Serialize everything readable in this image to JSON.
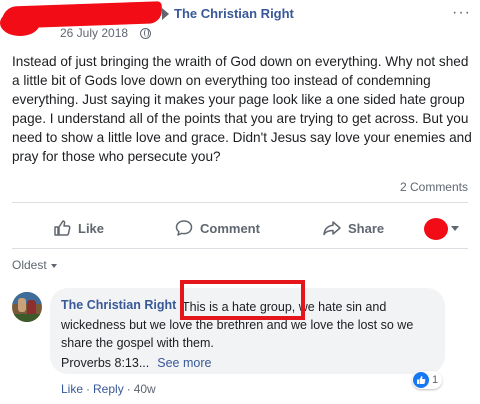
{
  "post": {
    "page_name": "The Christian Right",
    "date": "26 July 2018",
    "text": "Instead of just bringing the wraith of God down on everything. Why not shed a little bit of Gods love down on everything too instead of condemning everything. Just saying it makes your page look like a one sided hate group page. I understand all of the points that you are trying to get across. But you need to show a little love and grace. Didn't Jesus say love your enemies and pray for those who persecute you?",
    "comments_count": "2 Comments",
    "more_icon": "···"
  },
  "actions": {
    "like": "Like",
    "comment": "Comment",
    "share": "Share"
  },
  "sort": {
    "label": "Oldest"
  },
  "comment": {
    "author": "The Christian Right",
    "text": "This is a hate group, we hate sin and wickedness but we love the brethren and we love the lost so we share the gospel with them.",
    "link_text": "Proverbs 8:13...",
    "see_more": "See more",
    "reaction_count": "1",
    "like": "Like",
    "reply": "Reply",
    "age": "40w"
  },
  "colors": {
    "link_blue": "#385898",
    "redaction_red": "#f20c16",
    "highlight_red": "#e4151b",
    "like_blue": "#1877f2"
  }
}
